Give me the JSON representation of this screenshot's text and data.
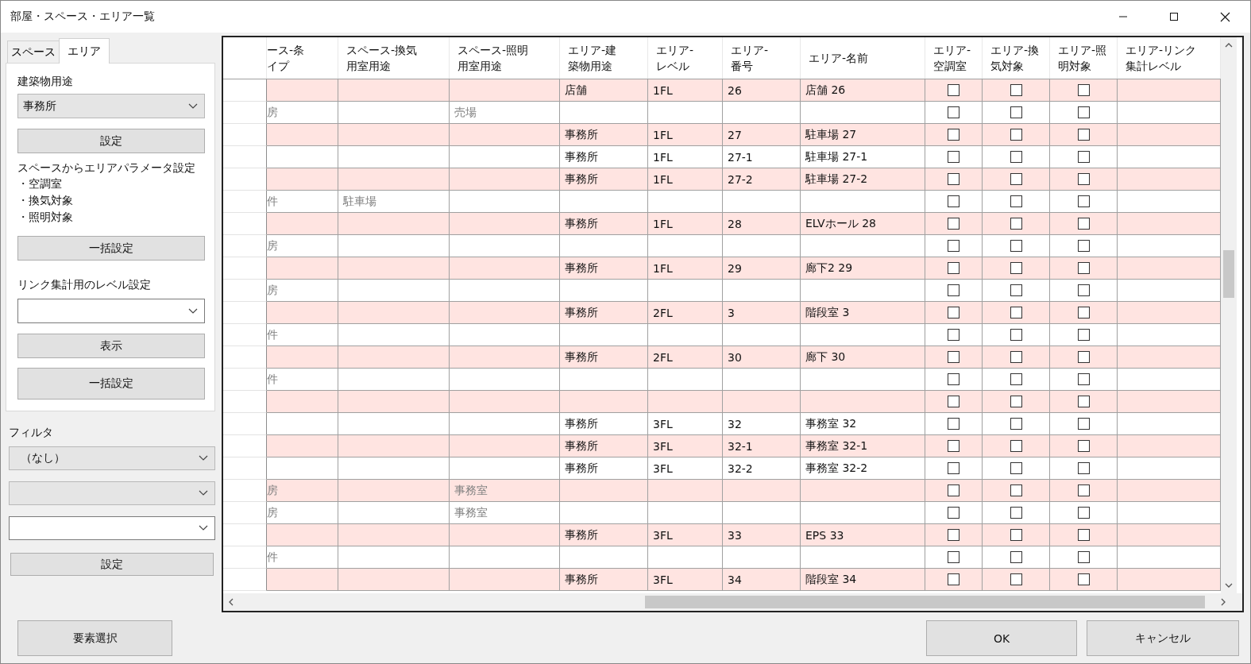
{
  "window": {
    "title": "部屋・スペース・エリア一覧"
  },
  "tabs": [
    {
      "label": "スペース",
      "selected": false
    },
    {
      "label": "エリア",
      "selected": true
    }
  ],
  "area_panel": {
    "building_use_label": "建築物用途",
    "building_use": "事務所",
    "set_button": "設定",
    "param_heading": "スペースからエリアパラメータ設定",
    "param_items": [
      "・空調室",
      "・換気対象",
      "・照明対象"
    ],
    "bulk_button": "一括設定",
    "link_level_label": "リンク集計用のレベル設定",
    "show_button": "表示",
    "bulk_button_2": "一括設定"
  },
  "filter": {
    "label": "フィルタ",
    "combos": [
      {
        "kind": "dropdown",
        "value": "（なし）"
      },
      {
        "kind": "dropdown"
      },
      {
        "kind": "editable"
      }
    ],
    "set_button": "設定"
  },
  "grid": {
    "columns": [
      {
        "kind": "space",
        "label_lines": [
          "ース-条",
          "イプ"
        ]
      },
      {
        "kind": "space",
        "label_lines": [
          "スペース-換気",
          "用室用途"
        ]
      },
      {
        "kind": "space",
        "label_lines": [
          "スペース-照明",
          "用室用途"
        ]
      },
      {
        "kind": "text",
        "label_lines": [
          "エリア-建",
          "築物用途"
        ]
      },
      {
        "kind": "text",
        "label_lines": [
          "エリア-",
          "レベル"
        ]
      },
      {
        "kind": "text",
        "label_lines": [
          "エリア-",
          "番号"
        ]
      },
      {
        "kind": "text",
        "label_lines": [
          "エリア-名前"
        ]
      },
      {
        "kind": "check",
        "label_lines": [
          "エリア-",
          "空調室"
        ]
      },
      {
        "kind": "check",
        "label_lines": [
          "エリア-換",
          "気対象"
        ]
      },
      {
        "kind": "check",
        "label_lines": [
          "エリア-照",
          "明対象"
        ]
      },
      {
        "kind": "text",
        "label_lines": [
          "エリア-リンク",
          "集計レベル"
        ]
      }
    ],
    "rows": [
      {
        "highlighted": true,
        "cells": [
          null,
          null,
          null,
          "店舗",
          "1FL",
          "26",
          "店舗 26",
          {
            "checked": false
          },
          {
            "checked": false
          },
          {
            "checked": false
          },
          null
        ]
      },
      {
        "highlighted": false,
        "cells": [
          "房",
          null,
          "売場",
          null,
          null,
          null,
          null,
          {
            "checked": false
          },
          {
            "checked": false
          },
          {
            "checked": false
          },
          null
        ]
      },
      {
        "highlighted": true,
        "cells": [
          null,
          null,
          null,
          "事務所",
          "1FL",
          "27",
          "駐車場 27",
          {
            "checked": false
          },
          {
            "checked": false
          },
          {
            "checked": false
          },
          null
        ]
      },
      {
        "highlighted": false,
        "cells": [
          null,
          null,
          null,
          "事務所",
          "1FL",
          "27-1",
          "駐車場 27-1",
          {
            "checked": false
          },
          {
            "checked": false
          },
          {
            "checked": false
          },
          null
        ]
      },
      {
        "highlighted": true,
        "cells": [
          null,
          null,
          null,
          "事務所",
          "1FL",
          "27-2",
          "駐車場 27-2",
          {
            "checked": false
          },
          {
            "checked": false
          },
          {
            "checked": false
          },
          null
        ]
      },
      {
        "highlighted": false,
        "cells": [
          "件",
          "駐車場",
          null,
          null,
          null,
          null,
          null,
          {
            "checked": false
          },
          {
            "checked": false
          },
          {
            "checked": false
          },
          null
        ]
      },
      {
        "highlighted": true,
        "cells": [
          null,
          null,
          null,
          "事務所",
          "1FL",
          "28",
          "ELVホール 28",
          {
            "checked": false
          },
          {
            "checked": false
          },
          {
            "checked": false
          },
          null
        ]
      },
      {
        "highlighted": false,
        "cells": [
          "房",
          null,
          null,
          null,
          null,
          null,
          null,
          {
            "checked": false
          },
          {
            "checked": false
          },
          {
            "checked": false
          },
          null
        ]
      },
      {
        "highlighted": true,
        "cells": [
          null,
          null,
          null,
          "事務所",
          "1FL",
          "29",
          "廊下2 29",
          {
            "checked": false
          },
          {
            "checked": false
          },
          {
            "checked": false
          },
          null
        ]
      },
      {
        "highlighted": false,
        "cells": [
          "房",
          null,
          null,
          null,
          null,
          null,
          null,
          {
            "checked": false
          },
          {
            "checked": false
          },
          {
            "checked": false
          },
          null
        ]
      },
      {
        "highlighted": true,
        "cells": [
          null,
          null,
          null,
          "事務所",
          "2FL",
          "3",
          "階段室 3",
          {
            "checked": false
          },
          {
            "checked": false
          },
          {
            "checked": false
          },
          null
        ]
      },
      {
        "highlighted": false,
        "cells": [
          "件",
          null,
          null,
          null,
          null,
          null,
          null,
          {
            "checked": false
          },
          {
            "checked": false
          },
          {
            "checked": false
          },
          null
        ]
      },
      {
        "highlighted": true,
        "cells": [
          null,
          null,
          null,
          "事務所",
          "2FL",
          "30",
          "廊下 30",
          {
            "checked": false
          },
          {
            "checked": false
          },
          {
            "checked": false
          },
          null
        ]
      },
      {
        "highlighted": false,
        "cells": [
          "件",
          null,
          null,
          null,
          null,
          null,
          null,
          {
            "checked": false
          },
          {
            "checked": false
          },
          {
            "checked": false
          },
          null
        ]
      },
      {
        "highlighted": true,
        "cells": [
          null,
          null,
          null,
          null,
          null,
          null,
          null,
          {
            "checked": false
          },
          {
            "checked": false
          },
          {
            "checked": false
          },
          null
        ]
      },
      {
        "highlighted": false,
        "cells": [
          null,
          null,
          null,
          "事務所",
          "3FL",
          "32",
          "事務室 32",
          {
            "checked": false
          },
          {
            "checked": false
          },
          {
            "checked": false
          },
          null
        ]
      },
      {
        "highlighted": true,
        "cells": [
          null,
          null,
          null,
          "事務所",
          "3FL",
          "32-1",
          "事務室 32-1",
          {
            "checked": false
          },
          {
            "checked": false
          },
          {
            "checked": false
          },
          null
        ]
      },
      {
        "highlighted": false,
        "cells": [
          null,
          null,
          null,
          "事務所",
          "3FL",
          "32-2",
          "事務室 32-2",
          {
            "checked": false
          },
          {
            "checked": false
          },
          {
            "checked": false
          },
          null
        ]
      },
      {
        "highlighted": true,
        "cells": [
          "房",
          null,
          "事務室",
          null,
          null,
          null,
          null,
          {
            "checked": false
          },
          {
            "checked": false
          },
          {
            "checked": false
          },
          null
        ]
      },
      {
        "highlighted": false,
        "cells": [
          "房",
          null,
          "事務室",
          null,
          null,
          null,
          null,
          {
            "checked": false
          },
          {
            "checked": false
          },
          {
            "checked": false
          },
          null
        ]
      },
      {
        "highlighted": true,
        "cells": [
          null,
          null,
          null,
          "事務所",
          "3FL",
          "33",
          "EPS 33",
          {
            "checked": false
          },
          {
            "checked": false
          },
          {
            "checked": false
          },
          null
        ]
      },
      {
        "highlighted": false,
        "cells": [
          "件",
          null,
          null,
          null,
          null,
          null,
          null,
          {
            "checked": false
          },
          {
            "checked": false
          },
          {
            "checked": false
          },
          null
        ]
      },
      {
        "highlighted": true,
        "cells": [
          null,
          null,
          null,
          "事務所",
          "3FL",
          "34",
          "階段室 34",
          {
            "checked": false
          },
          {
            "checked": false
          },
          {
            "checked": false
          },
          null
        ]
      }
    ]
  },
  "buttons": {
    "select_elements": "要素選択",
    "ok": "OK",
    "cancel": "キャンセル"
  }
}
